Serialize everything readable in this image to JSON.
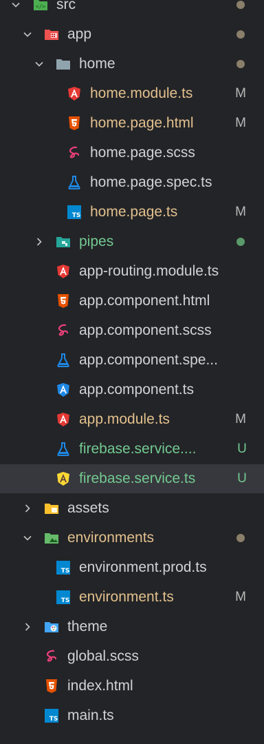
{
  "tree": [
    {
      "label": "src",
      "type": "folder",
      "expanded": true,
      "icon": "folder-src-icon",
      "depth": 0,
      "status": "",
      "decoration": "dot",
      "color": "normal"
    },
    {
      "label": "app",
      "type": "folder",
      "expanded": true,
      "icon": "folder-app-icon",
      "depth": 1,
      "status": "",
      "decoration": "dot",
      "color": "normal"
    },
    {
      "label": "home",
      "type": "folder",
      "expanded": true,
      "icon": "folder-icon",
      "depth": 2,
      "status": "",
      "decoration": "dot",
      "color": "normal"
    },
    {
      "label": "home.module.ts",
      "type": "file",
      "icon": "angular-icon",
      "depth": 3,
      "status": "M",
      "color": "modified"
    },
    {
      "label": "home.page.html",
      "type": "file",
      "icon": "html5-icon",
      "depth": 3,
      "status": "M",
      "color": "modified"
    },
    {
      "label": "home.page.scss",
      "type": "file",
      "icon": "sass-icon",
      "depth": 3,
      "status": "",
      "color": "normal"
    },
    {
      "label": "home.page.spec.ts",
      "type": "file",
      "icon": "test-flask-icon",
      "depth": 3,
      "status": "",
      "color": "normal"
    },
    {
      "label": "home.page.ts",
      "type": "file",
      "icon": "typescript-icon",
      "depth": 3,
      "status": "M",
      "color": "modified"
    },
    {
      "label": "pipes",
      "type": "folder",
      "expanded": false,
      "icon": "folder-pipes-icon",
      "depth": 2,
      "status": "",
      "decoration": "dot-green",
      "color": "pipes"
    },
    {
      "label": "app-routing.module.ts",
      "type": "file",
      "icon": "angular-icon",
      "depth": 2,
      "status": "",
      "color": "normal"
    },
    {
      "label": "app.component.html",
      "type": "file",
      "icon": "html5-icon",
      "depth": 2,
      "status": "",
      "color": "normal"
    },
    {
      "label": "app.component.scss",
      "type": "file",
      "icon": "sass-icon",
      "depth": 2,
      "status": "",
      "color": "normal"
    },
    {
      "label": "app.component.spe...",
      "type": "file",
      "icon": "test-flask-icon",
      "depth": 2,
      "status": "",
      "color": "normal"
    },
    {
      "label": "app.component.ts",
      "type": "file",
      "icon": "angular-component-icon",
      "depth": 2,
      "status": "",
      "color": "normal"
    },
    {
      "label": "app.module.ts",
      "type": "file",
      "icon": "angular-icon",
      "depth": 2,
      "status": "M",
      "color": "modified"
    },
    {
      "label": "firebase.service....",
      "type": "file",
      "icon": "test-flask-icon",
      "depth": 2,
      "status": "U",
      "color": "untracked"
    },
    {
      "label": "firebase.service.ts",
      "type": "file",
      "icon": "angular-service-icon",
      "depth": 2,
      "status": "U",
      "color": "untracked",
      "selected": true
    },
    {
      "label": "assets",
      "type": "folder",
      "expanded": false,
      "icon": "folder-assets-icon",
      "depth": 1,
      "status": "",
      "color": "normal"
    },
    {
      "label": "environments",
      "type": "folder",
      "expanded": true,
      "icon": "folder-environment-icon",
      "depth": 1,
      "status": "",
      "decoration": "dot",
      "color": "modified"
    },
    {
      "label": "environment.prod.ts",
      "type": "file",
      "icon": "typescript-icon",
      "depth": 2,
      "status": "",
      "color": "normal"
    },
    {
      "label": "environment.ts",
      "type": "file",
      "icon": "typescript-icon",
      "depth": 2,
      "status": "M",
      "color": "modified"
    },
    {
      "label": "theme",
      "type": "folder",
      "expanded": false,
      "icon": "folder-theme-icon",
      "depth": 1,
      "status": "",
      "color": "normal"
    },
    {
      "label": "global.scss",
      "type": "file",
      "icon": "sass-icon",
      "depth": 1,
      "status": "",
      "color": "normal"
    },
    {
      "label": "index.html",
      "type": "file",
      "icon": "html5-icon",
      "depth": 1,
      "status": "",
      "color": "normal"
    },
    {
      "label": "main.ts",
      "type": "file",
      "icon": "typescript-icon",
      "depth": 1,
      "status": "",
      "color": "normal"
    }
  ],
  "colors": {
    "background": "#232427",
    "selected": "#37383d",
    "modified": "#e2c08d",
    "untracked": "#73c991"
  }
}
